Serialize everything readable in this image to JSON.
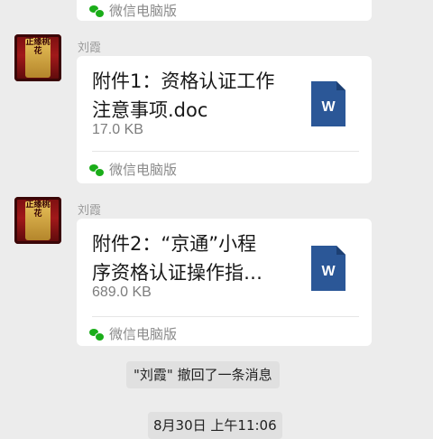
{
  "messages": [
    {
      "sender": "刘霞",
      "avatar_text": "正缘桃花",
      "file_title": "附件1：资格认证工作注意事项.doc",
      "file_title_line1": "附件1：资格认证工作",
      "file_title_line2": "注意事项.doc",
      "file_size": "17.0 KB",
      "source": "微信电脑版",
      "file_icon": "word-doc-icon"
    },
    {
      "sender": "刘霞",
      "avatar_text": "正缘桃花",
      "file_title_line1": "附件2：“京通”小程",
      "file_title_line2": "序资格认证操作指…",
      "file_size": "689.0 KB",
      "source": "微信电脑版",
      "file_icon": "word-doc-icon"
    }
  ],
  "top_partial_source": "微信电脑版",
  "recall_notice": "\"刘霞\" 撤回了一条消息",
  "timestamp": "8月30日 上午11:06",
  "colors": {
    "background": "#ececec",
    "bubble": "#ffffff",
    "word_blue": "#2b5797",
    "wechat_green": "#1aad19"
  }
}
